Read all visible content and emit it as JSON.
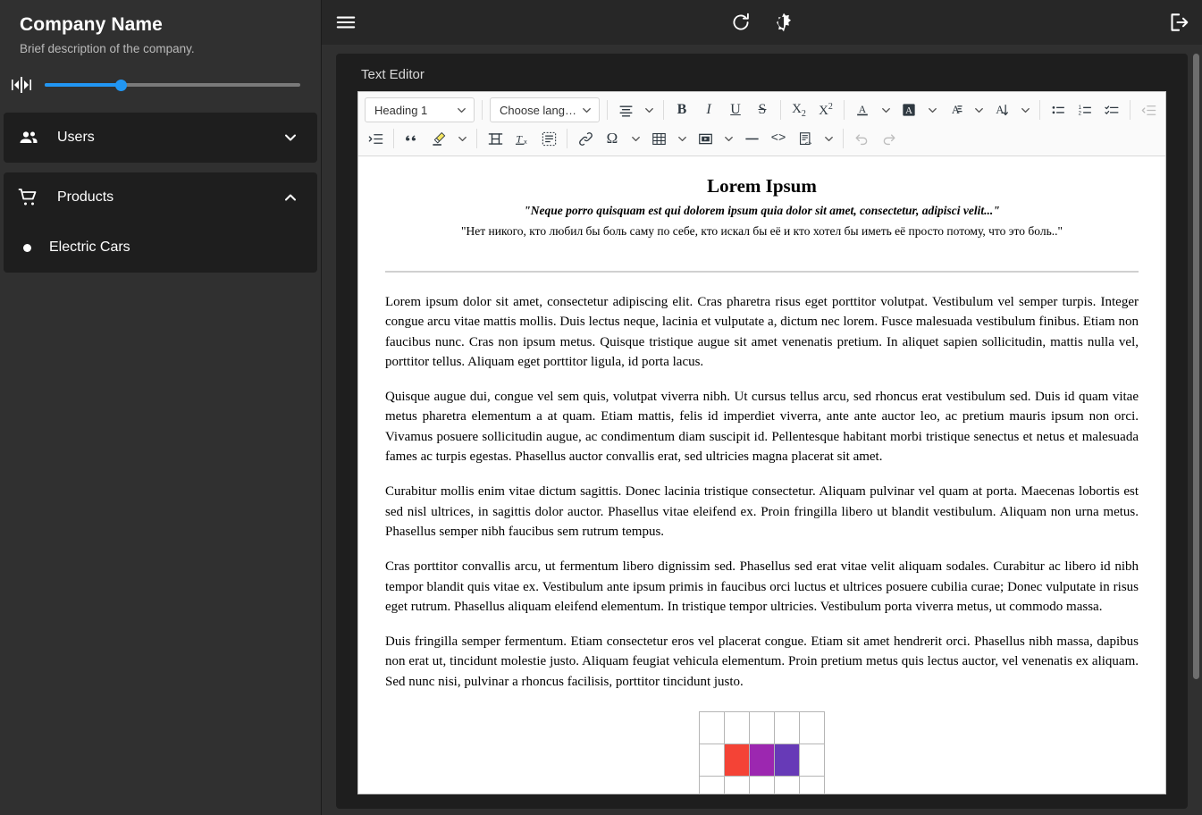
{
  "sidebar": {
    "company_name": "Company Name",
    "company_description": "Brief description of the company.",
    "resize_icon": "resize-width-icon",
    "slider": {
      "value": 30,
      "min": 0,
      "max": 100
    },
    "groups": [
      {
        "label": "Users",
        "icon": "people-icon",
        "chevron": "chevron-down-icon",
        "expanded": false,
        "items": []
      },
      {
        "label": "Products",
        "icon": "shopping-cart-icon",
        "chevron": "chevron-up-icon",
        "expanded": true,
        "items": [
          {
            "label": "Electric Cars",
            "bullet": "dot-icon"
          }
        ]
      }
    ]
  },
  "appbar": {
    "menu_icon": "hamburger-menu-icon",
    "refresh_icon": "refresh-icon",
    "theme_icon": "dark-mode-brightness-icon",
    "logout_icon": "logout-icon"
  },
  "panel": {
    "title": "Text Editor"
  },
  "toolbar": {
    "row1": {
      "paragraph_style": {
        "value": "Heading 1",
        "icon": "chevron-down-icon"
      },
      "language": {
        "value": "Choose lang…",
        "icon": "chevron-down-icon"
      },
      "alignment": {
        "icon": "align-center-icon",
        "caret": "chevron-down-icon"
      },
      "bold": {
        "label": "B",
        "icon": "bold-icon"
      },
      "italic": {
        "label": "I",
        "icon": "italic-icon"
      },
      "underline": {
        "label": "U",
        "icon": "underline-icon"
      },
      "strikethrough": {
        "label": "S",
        "icon": "strikethrough-icon"
      },
      "subscript": {
        "label": "X2",
        "icon": "subscript-icon"
      },
      "superscript": {
        "label": "X2",
        "icon": "superscript-icon"
      },
      "font_color": {
        "label": "A",
        "icon": "font-color-icon",
        "caret": "chevron-down-icon"
      },
      "background_color": {
        "label": "A",
        "icon": "background-color-icon",
        "caret": "chevron-down-icon"
      },
      "font_family": {
        "icon": "font-family-icon",
        "caret": "chevron-down-icon"
      },
      "font_size": {
        "icon": "font-size-icon",
        "caret": "chevron-down-icon"
      },
      "bulleted_list": {
        "icon": "bulleted-list-icon"
      },
      "numbered_list": {
        "icon": "numbered-list-icon"
      },
      "todo_list": {
        "icon": "todo-list-icon"
      },
      "outdent": {
        "icon": "outdent-icon"
      }
    },
    "row2": {
      "indent": {
        "icon": "indent-icon"
      },
      "blockquote": {
        "icon": "blockquote-icon"
      },
      "highlight": {
        "icon": "highlighter-icon",
        "caret": "chevron-down-icon",
        "color": "#f5e663"
      },
      "page_break": {
        "icon": "page-break-icon"
      },
      "remove_format": {
        "icon": "remove-format-icon"
      },
      "select_all": {
        "icon": "select-all-icon"
      },
      "link": {
        "icon": "link-icon"
      },
      "special_character": {
        "label": "Ω",
        "icon": "special-character-icon",
        "caret": "chevron-down-icon"
      },
      "table": {
        "icon": "insert-table-icon",
        "caret": "chevron-down-icon"
      },
      "media": {
        "icon": "insert-media-icon",
        "caret": "chevron-down-icon"
      },
      "horizontal_line": {
        "icon": "horizontal-line-icon"
      },
      "source_code": {
        "label": "<>",
        "icon": "source-code-icon"
      },
      "code_block": {
        "icon": "code-block-icon",
        "caret": "chevron-down-icon"
      },
      "undo": {
        "icon": "undo-icon"
      },
      "redo": {
        "icon": "redo-icon"
      }
    }
  },
  "document": {
    "title": "Lorem Ipsum",
    "quote_latin": "\"Neque porro quisquam est qui dolorem ipsum quia dolor sit amet, consectetur, adipisci velit...\"",
    "quote_russian": "\"Нет никого, кто любил бы боль саму по себе, кто искал бы её и кто хотел бы иметь её просто потому, что это боль..\"",
    "paragraphs": [
      "Lorem ipsum dolor sit amet, consectetur adipiscing elit. Cras pharetra risus eget porttitor volutpat. Vestibulum vel semper turpis. Integer congue arcu vitae mattis mollis. Duis lectus neque, lacinia et vulputate a, dictum nec lorem. Fusce malesuada vestibulum finibus. Etiam non faucibus nunc. Cras non ipsum metus. Quisque tristique augue sit amet venenatis pretium. In aliquet sapien sollicitudin, mattis nulla vel, porttitor tellus. Aliquam eget porttitor ligula, id porta lacus.",
      "Quisque augue dui, congue vel sem quis, volutpat viverra nibh. Ut cursus tellus arcu, sed rhoncus erat vestibulum sed. Duis id quam vitae metus pharetra elementum a at quam. Etiam mattis, felis id imperdiet viverra, ante ante auctor leo, ac pretium mauris ipsum non orci. Vivamus posuere sollicitudin augue, ac condimentum diam suscipit id. Pellentesque habitant morbi tristique senectus et netus et malesuada fames ac turpis egestas. Phasellus auctor convallis erat, sed ultricies magna placerat sit amet.",
      "Curabitur mollis enim vitae dictum sagittis. Donec lacinia tristique consectetur. Aliquam pulvinar vel quam at porta. Maecenas lobortis est sed nisl ultrices, in sagittis dolor auctor. Phasellus vitae eleifend ex. Proin fringilla libero ut blandit vestibulum. Aliquam non urna metus. Phasellus semper nibh faucibus sem rutrum tempus.",
      "Cras porttitor convallis arcu, ut fermentum libero dignissim sed. Phasellus sed erat vitae velit aliquam sodales. Curabitur ac libero id nibh tempor blandit quis vitae ex. Vestibulum ante ipsum primis in faucibus orci luctus et ultrices posuere cubilia curae; Donec vulputate in risus eget rutrum. Phasellus aliquam eleifend elementum. In tristique tempor ultricies. Vestibulum porta viverra metus, ut commodo massa.",
      "Duis fringilla semper fermentum. Etiam consectetur eros vel placerat congue. Etiam sit amet hendrerit orci. Phasellus nibh massa, dapibus non erat ut, tincidunt molestie justo. Aliquam feugiat vehicula elementum. Proin pretium metus quis lectus auctor, vel venenatis ex aliquam. Sed nunc nisi, pulvinar a rhoncus facilisis, porttitor tincidunt justo."
    ],
    "table": {
      "rows": 3,
      "cols": 5,
      "cells": [
        [
          "",
          "",
          "",
          "",
          ""
        ],
        [
          "",
          "#f44336",
          "#9c27b0",
          "#673ab7",
          ""
        ],
        [
          "",
          "",
          "",
          "",
          ""
        ]
      ]
    }
  },
  "colors": {
    "accent": "#2196f3",
    "sidebar_bg": "#303030",
    "card_bg": "#1e1e1e",
    "appbar_bg": "#272727"
  }
}
